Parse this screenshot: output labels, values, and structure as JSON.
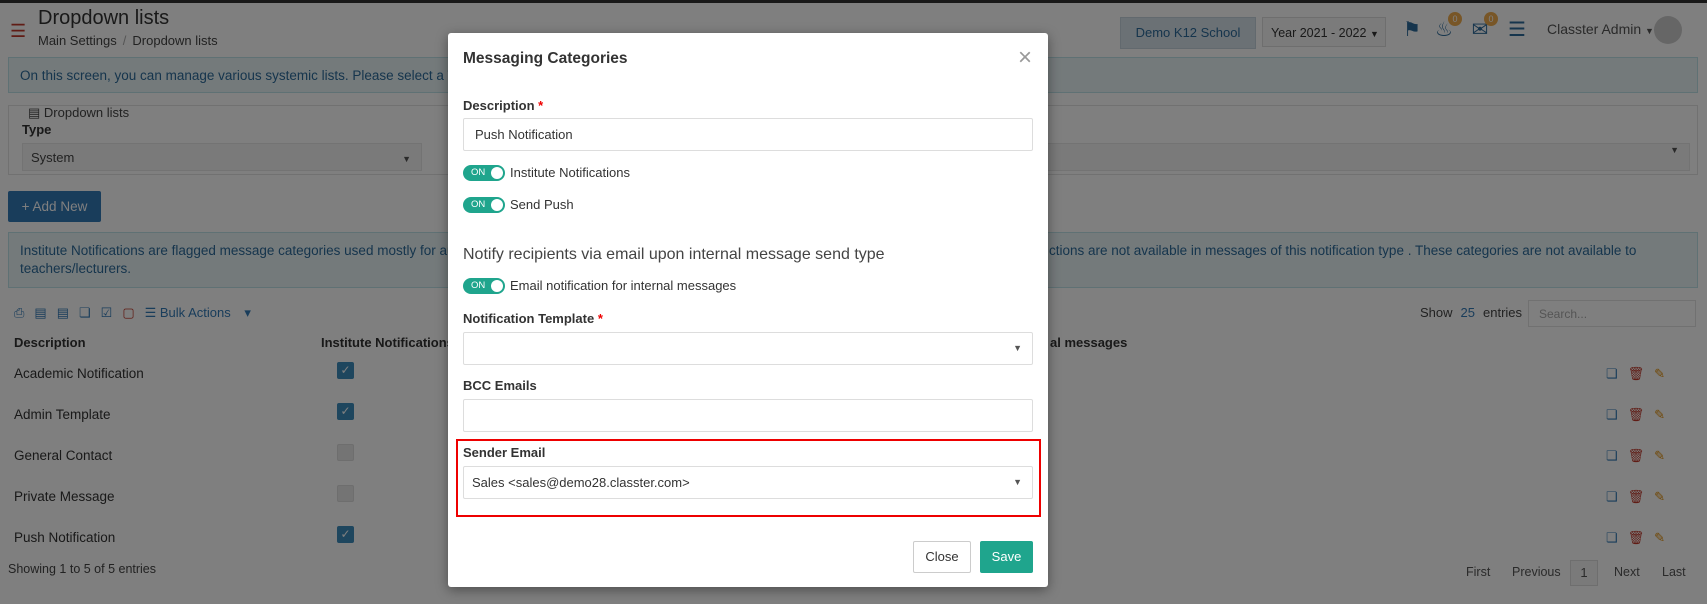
{
  "header": {
    "title": "Dropdown lists",
    "breadcrumb": [
      "Main Settings",
      "Dropdown lists"
    ],
    "school": "Demo K12 School",
    "year": "Year 2021 - 2022",
    "notif_badge": "0",
    "msg_badge": "0",
    "user": "Classter Admin"
  },
  "page": {
    "info_text": "On this screen, you can manage various systemic lists. Please select a Type",
    "panel_title": "Dropdown lists",
    "type_label": "Type",
    "type_value": "System",
    "add_new": "Add New",
    "info2_left": "Institute Notifications are flagged message categories used mostly for auto",
    "info2_right": "ctions are not available in messages of this notification type . These categories are not available to",
    "info2_line2": "teachers/lecturers.",
    "bulk_actions": "Bulk Actions",
    "show_label": "Show",
    "show_count": "25",
    "entries_label": "entries",
    "search_placeholder": "Search...",
    "col_description": "Description",
    "col_institute": "Institute Notifications",
    "col_internal": "al messages",
    "rows": [
      {
        "desc": "Academic Notification",
        "checked": true
      },
      {
        "desc": "Admin Template",
        "checked": true
      },
      {
        "desc": "General Contact",
        "checked": false
      },
      {
        "desc": "Private Message",
        "checked": false
      },
      {
        "desc": "Push Notification",
        "checked": true
      }
    ],
    "footer": "Showing 1 to 5 of 5 entries",
    "pager": {
      "first": "First",
      "previous": "Previous",
      "page": "1",
      "next": "Next",
      "last": "Last"
    }
  },
  "modal": {
    "title": "Messaging Categories",
    "description_label": "Description",
    "description_value": "Push Notification",
    "toggle_on": "ON",
    "toggle1_label": "Institute Notifications",
    "toggle2_label": "Send Push",
    "section_heading": "Notify recipients via email upon internal message send type",
    "toggle3_label": "Email notification for internal messages",
    "template_label": "Notification Template",
    "bcc_label": "BCC Emails",
    "sender_label": "Sender Email",
    "sender_value": "Sales <sales@demo28.classter.com>",
    "close_btn": "Close",
    "save_btn": "Save"
  }
}
